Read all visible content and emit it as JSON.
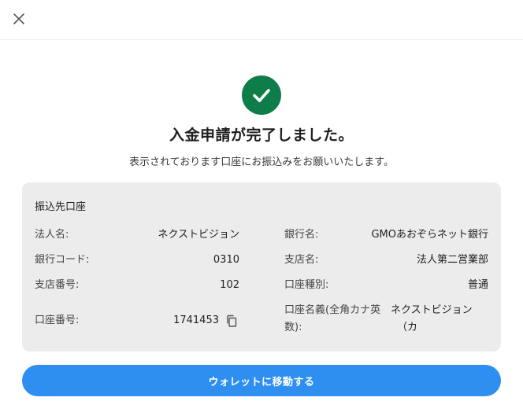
{
  "header": {
    "close_icon": "close-icon"
  },
  "status": {
    "icon": "check-circle-icon",
    "icon_color": "#0f7d49",
    "title": "入金申請が完了しました。",
    "message": "表示されております口座にお振込みをお願いいたします。"
  },
  "card": {
    "title": "振込先口座",
    "left": [
      {
        "label": "法人名:",
        "value": "ネクストビジョン"
      },
      {
        "label": "銀行コード:",
        "value": "0310"
      },
      {
        "label": "支店番号:",
        "value": "102"
      },
      {
        "label": "口座番号:",
        "value": "1741453"
      }
    ],
    "right": [
      {
        "label": "銀行名:",
        "value": "GMOあおぞらネット銀行"
      },
      {
        "label": "支店名:",
        "value": "法人第二営業部"
      },
      {
        "label": "口座種別:",
        "value": "普通"
      },
      {
        "label_line1": "口座名義(全角カナ英",
        "label_line2": "数):",
        "value_line1": "ネクストビジョン",
        "value_line2": "（カ"
      }
    ]
  },
  "actions": {
    "primary_label": "ウォレットに移動する",
    "primary_color": "#2e8ff0"
  }
}
